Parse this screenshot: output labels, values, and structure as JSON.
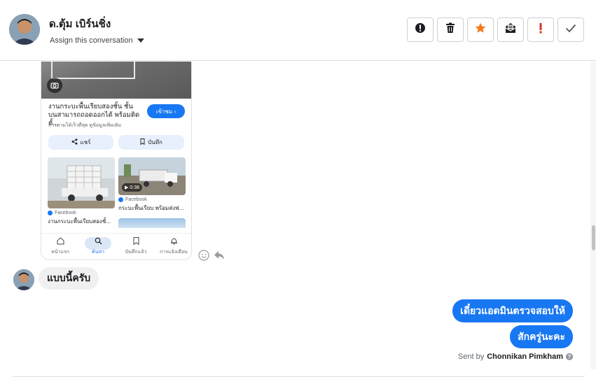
{
  "header": {
    "contact_name": "ด.ตุ้ม เบิร์นชิ่ง",
    "assign_label": "Assign this conversation",
    "toolbar": [
      {
        "name": "report-spam-icon"
      },
      {
        "name": "trash-icon"
      },
      {
        "name": "star-icon",
        "color": "#f37b1d"
      },
      {
        "name": "mark-unread-icon"
      },
      {
        "name": "important-icon",
        "color": "#d93025"
      },
      {
        "name": "checkmark-icon"
      }
    ]
  },
  "shared_screenshot": {
    "ad_title": "งานกระบะพื้นเรียบสองชั้น ชั้นบนสามารถถอดออกได้ พร้อมติดตั้...",
    "ad_subtitle": "การตามได้เร็วที่สุด ดูข้อมูลเพิ่มเติม",
    "cta_label": "เข้าชม ›",
    "share_label": "แชร์",
    "save_label": "บันทึก",
    "cards": [
      {
        "source": "Facebook",
        "caption": "งานกระบะพื้นเรียบสองชั้..."
      },
      {
        "source": "Facebook",
        "caption": "กระบะพื้นเรียบ พร้อมส่งฟ...",
        "duration": "0:38"
      }
    ],
    "nav": [
      {
        "label": "หน้าแรก",
        "icon": "home-icon"
      },
      {
        "label": "ค้นหา",
        "icon": "search-icon",
        "active": true
      },
      {
        "label": "บันทึกแล้ว",
        "icon": "bookmark-icon"
      },
      {
        "label": "การแจ้งเตือน",
        "icon": "bell-icon"
      }
    ]
  },
  "messages": {
    "incoming": "แบบนี้ครับ",
    "outgoing": [
      "เดี๋ยวแอดมินตรวจสอบให้",
      "สักครู่นะคะ"
    ],
    "sent_by_prefix": "Sent by",
    "sent_by_name": "Chonnikan Pimkham"
  },
  "colors": {
    "accent": "#1877f2",
    "bubble_incoming": "#f0f0f0"
  }
}
